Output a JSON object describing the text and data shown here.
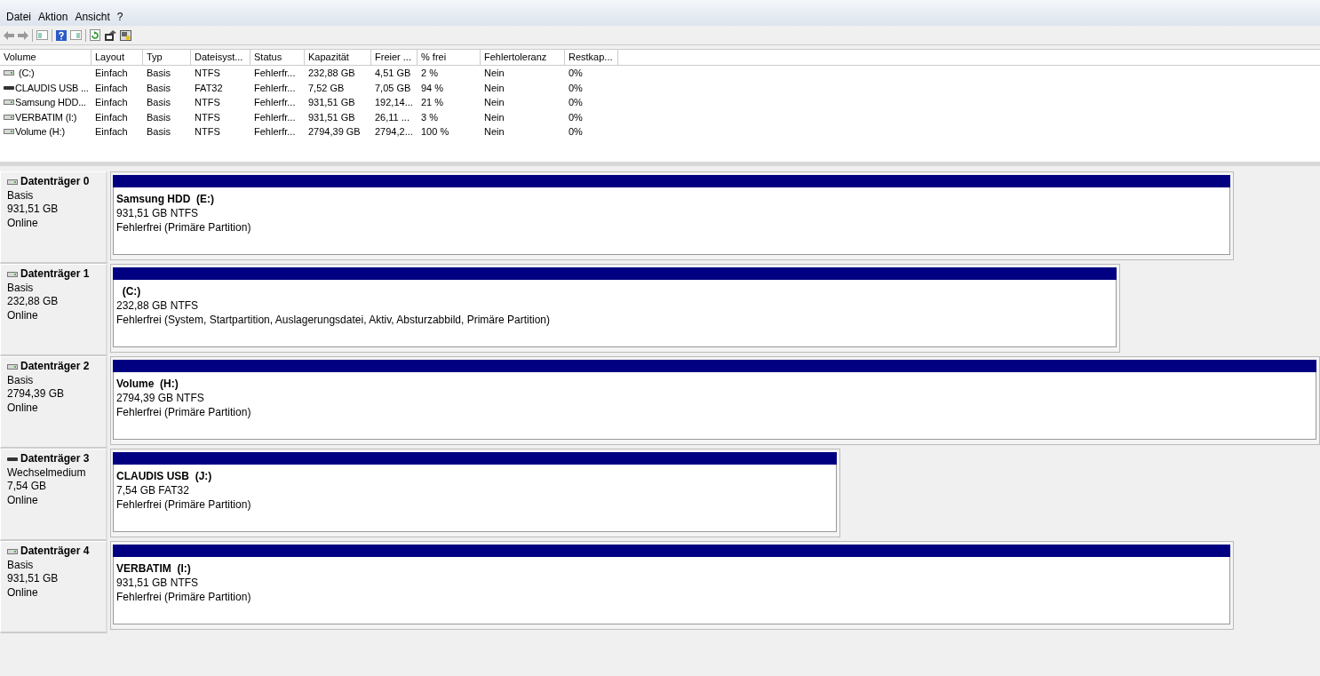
{
  "menu": [
    "Datei",
    "Aktion",
    "Ansicht",
    "?"
  ],
  "table": {
    "columns": [
      "Volume",
      "Layout",
      "Typ",
      "Dateisyst...",
      "Status",
      "Kapazität",
      "Freier ...",
      "% frei",
      "Fehlertoleranz",
      "Restkap..."
    ],
    "rows": [
      {
        "kind": "fixed",
        "cells": [
          "(C:)",
          "Einfach",
          "Basis",
          "NTFS",
          "Fehlerfr...",
          "232,88 GB",
          "4,51 GB",
          "2 %",
          "Nein",
          "0%"
        ]
      },
      {
        "kind": "removable",
        "cells": [
          "CLAUDIS USB ...",
          "Einfach",
          "Basis",
          "FAT32",
          "Fehlerfr...",
          "7,52 GB",
          "7,05 GB",
          "94 %",
          "Nein",
          "0%"
        ]
      },
      {
        "kind": "fixed",
        "cells": [
          "Samsung HDD...",
          "Einfach",
          "Basis",
          "NTFS",
          "Fehlerfr...",
          "931,51 GB",
          "192,14...",
          "21 %",
          "Nein",
          "0%"
        ]
      },
      {
        "kind": "fixed",
        "cells": [
          "VERBATIM (I:)",
          "Einfach",
          "Basis",
          "NTFS",
          "Fehlerfr...",
          "931,51 GB",
          "26,11 ...",
          "3 %",
          "Nein",
          "0%"
        ]
      },
      {
        "kind": "fixed",
        "cells": [
          "Volume (H:)",
          "Einfach",
          "Basis",
          "NTFS",
          "Fehlerfr...",
          "2794,39 GB",
          "2794,2...",
          "100 %",
          "Nein",
          "0%"
        ]
      }
    ]
  },
  "disks": [
    {
      "kind": "fixed",
      "name": "Datenträger 0",
      "type": "Basis",
      "size": "931,51 GB",
      "state": "Online",
      "partition": {
        "name": "Samsung HDD  (E:)",
        "size": "931,51 GB NTFS",
        "status": "Fehlerfrei (Primäre Partition)"
      }
    },
    {
      "kind": "fixed",
      "name": "Datenträger 1",
      "type": "Basis",
      "size": "232,88 GB",
      "state": "Online",
      "partition": {
        "name": "  (C:)",
        "size": "232,88 GB NTFS",
        "status": "Fehlerfrei (System, Startpartition, Auslagerungsdatei, Aktiv, Absturzabbild, Primäre Partition)"
      }
    },
    {
      "kind": "fixed",
      "name": "Datenträger 2",
      "type": "Basis",
      "size": "2794,39 GB",
      "state": "Online",
      "partition": {
        "name": "Volume  (H:)",
        "size": "2794,39 GB NTFS",
        "status": "Fehlerfrei (Primäre Partition)"
      }
    },
    {
      "kind": "removable",
      "name": "Datenträger 3",
      "type": "Wechselmedium",
      "size": "7,54 GB",
      "state": "Online",
      "partition": {
        "name": "CLAUDIS USB  (J:)",
        "size": "7,54 GB FAT32",
        "status": "Fehlerfrei (Primäre Partition)"
      }
    },
    {
      "kind": "fixed",
      "name": "Datenträger 4",
      "type": "Basis",
      "size": "931,51 GB",
      "state": "Online",
      "partition": {
        "name": "VERBATIM  (I:)",
        "size": "931,51 GB NTFS",
        "status": "Fehlerfrei (Primäre Partition)"
      }
    }
  ]
}
